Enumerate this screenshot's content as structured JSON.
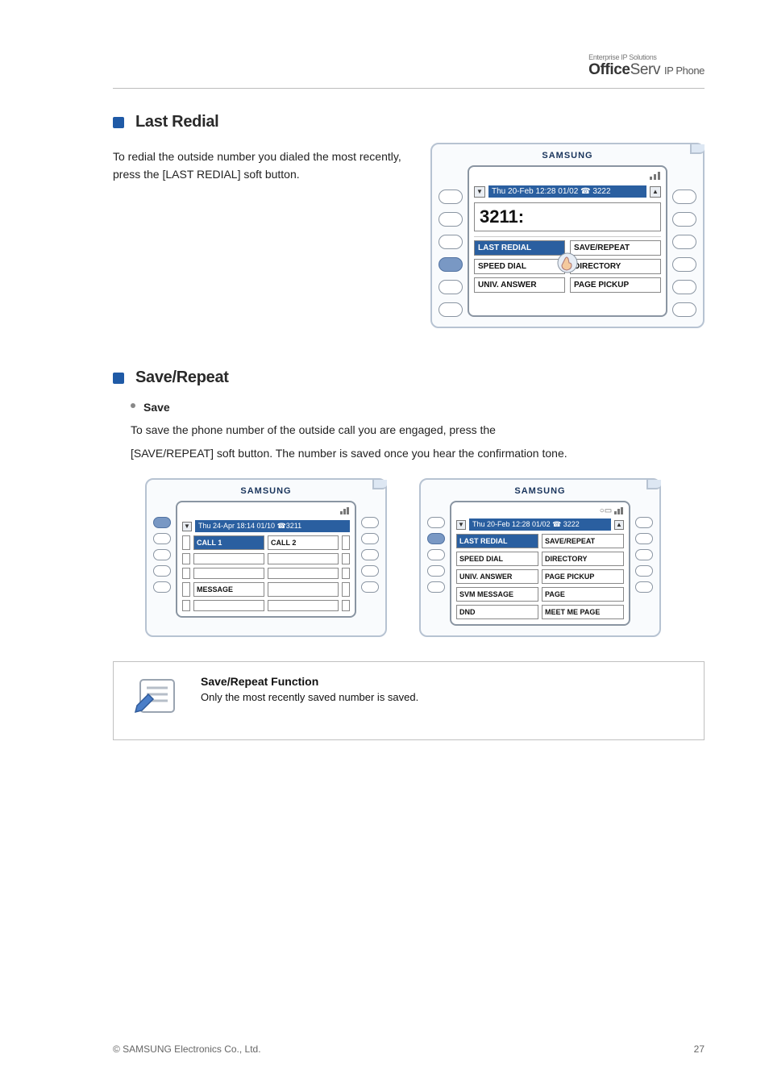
{
  "header": {
    "tagline": "Enterprise IP Solutions",
    "logo_bold": "Office",
    "logo_light": "Serv",
    "logo_suffix": "IP Phone"
  },
  "section1": {
    "heading": "Last Redial",
    "para": "To redial the outside number you dialed the most recently, press the [LAST REDIAL] soft button.",
    "phone": {
      "brand": "SAMSUNG",
      "status": "Thu 20-Feb 12:28 01/02 ☎ 3222",
      "extension": "3211:",
      "softkeys_left": [
        "LAST REDIAL",
        "SPEED DIAL",
        "UNIV. ANSWER"
      ],
      "softkeys_right": [
        "SAVE/REPEAT",
        "DIRECTORY",
        "PAGE PICKUP"
      ]
    }
  },
  "section2": {
    "heading": "Save/Repeat",
    "bullet": "Save",
    "para1": "To save the phone number of the outside call you are engaged, press the",
    "para2": "[SAVE/REPEAT] soft button. The number is saved once you hear the confirmation tone.",
    "phoneA": {
      "brand": "SAMSUNG",
      "status": "Thu 24-Apr 18:14 01/10 ☎3211",
      "rows": [
        [
          "CALL 1",
          "CALL 2"
        ],
        [
          "",
          ""
        ],
        [
          "",
          ""
        ],
        [
          "MESSAGE",
          ""
        ],
        [
          "",
          ""
        ]
      ]
    },
    "phoneB": {
      "brand": "SAMSUNG",
      "status": "Thu 20-Feb 12:28 01/02 ☎ 3222",
      "rows_left": [
        "LAST REDIAL",
        "SPEED DIAL",
        "UNIV. ANSWER",
        "SVM MESSAGE",
        "DND"
      ],
      "rows_right": [
        "SAVE/REPEAT",
        "DIRECTORY",
        "PAGE PICKUP",
        "PAGE",
        "MEET ME PAGE"
      ]
    }
  },
  "note": {
    "title": "Save/Repeat Function",
    "body": "Only the most recently saved number is saved."
  },
  "page_footer": {
    "copyright": "© SAMSUNG Electronics Co., Ltd.",
    "page": "27"
  }
}
